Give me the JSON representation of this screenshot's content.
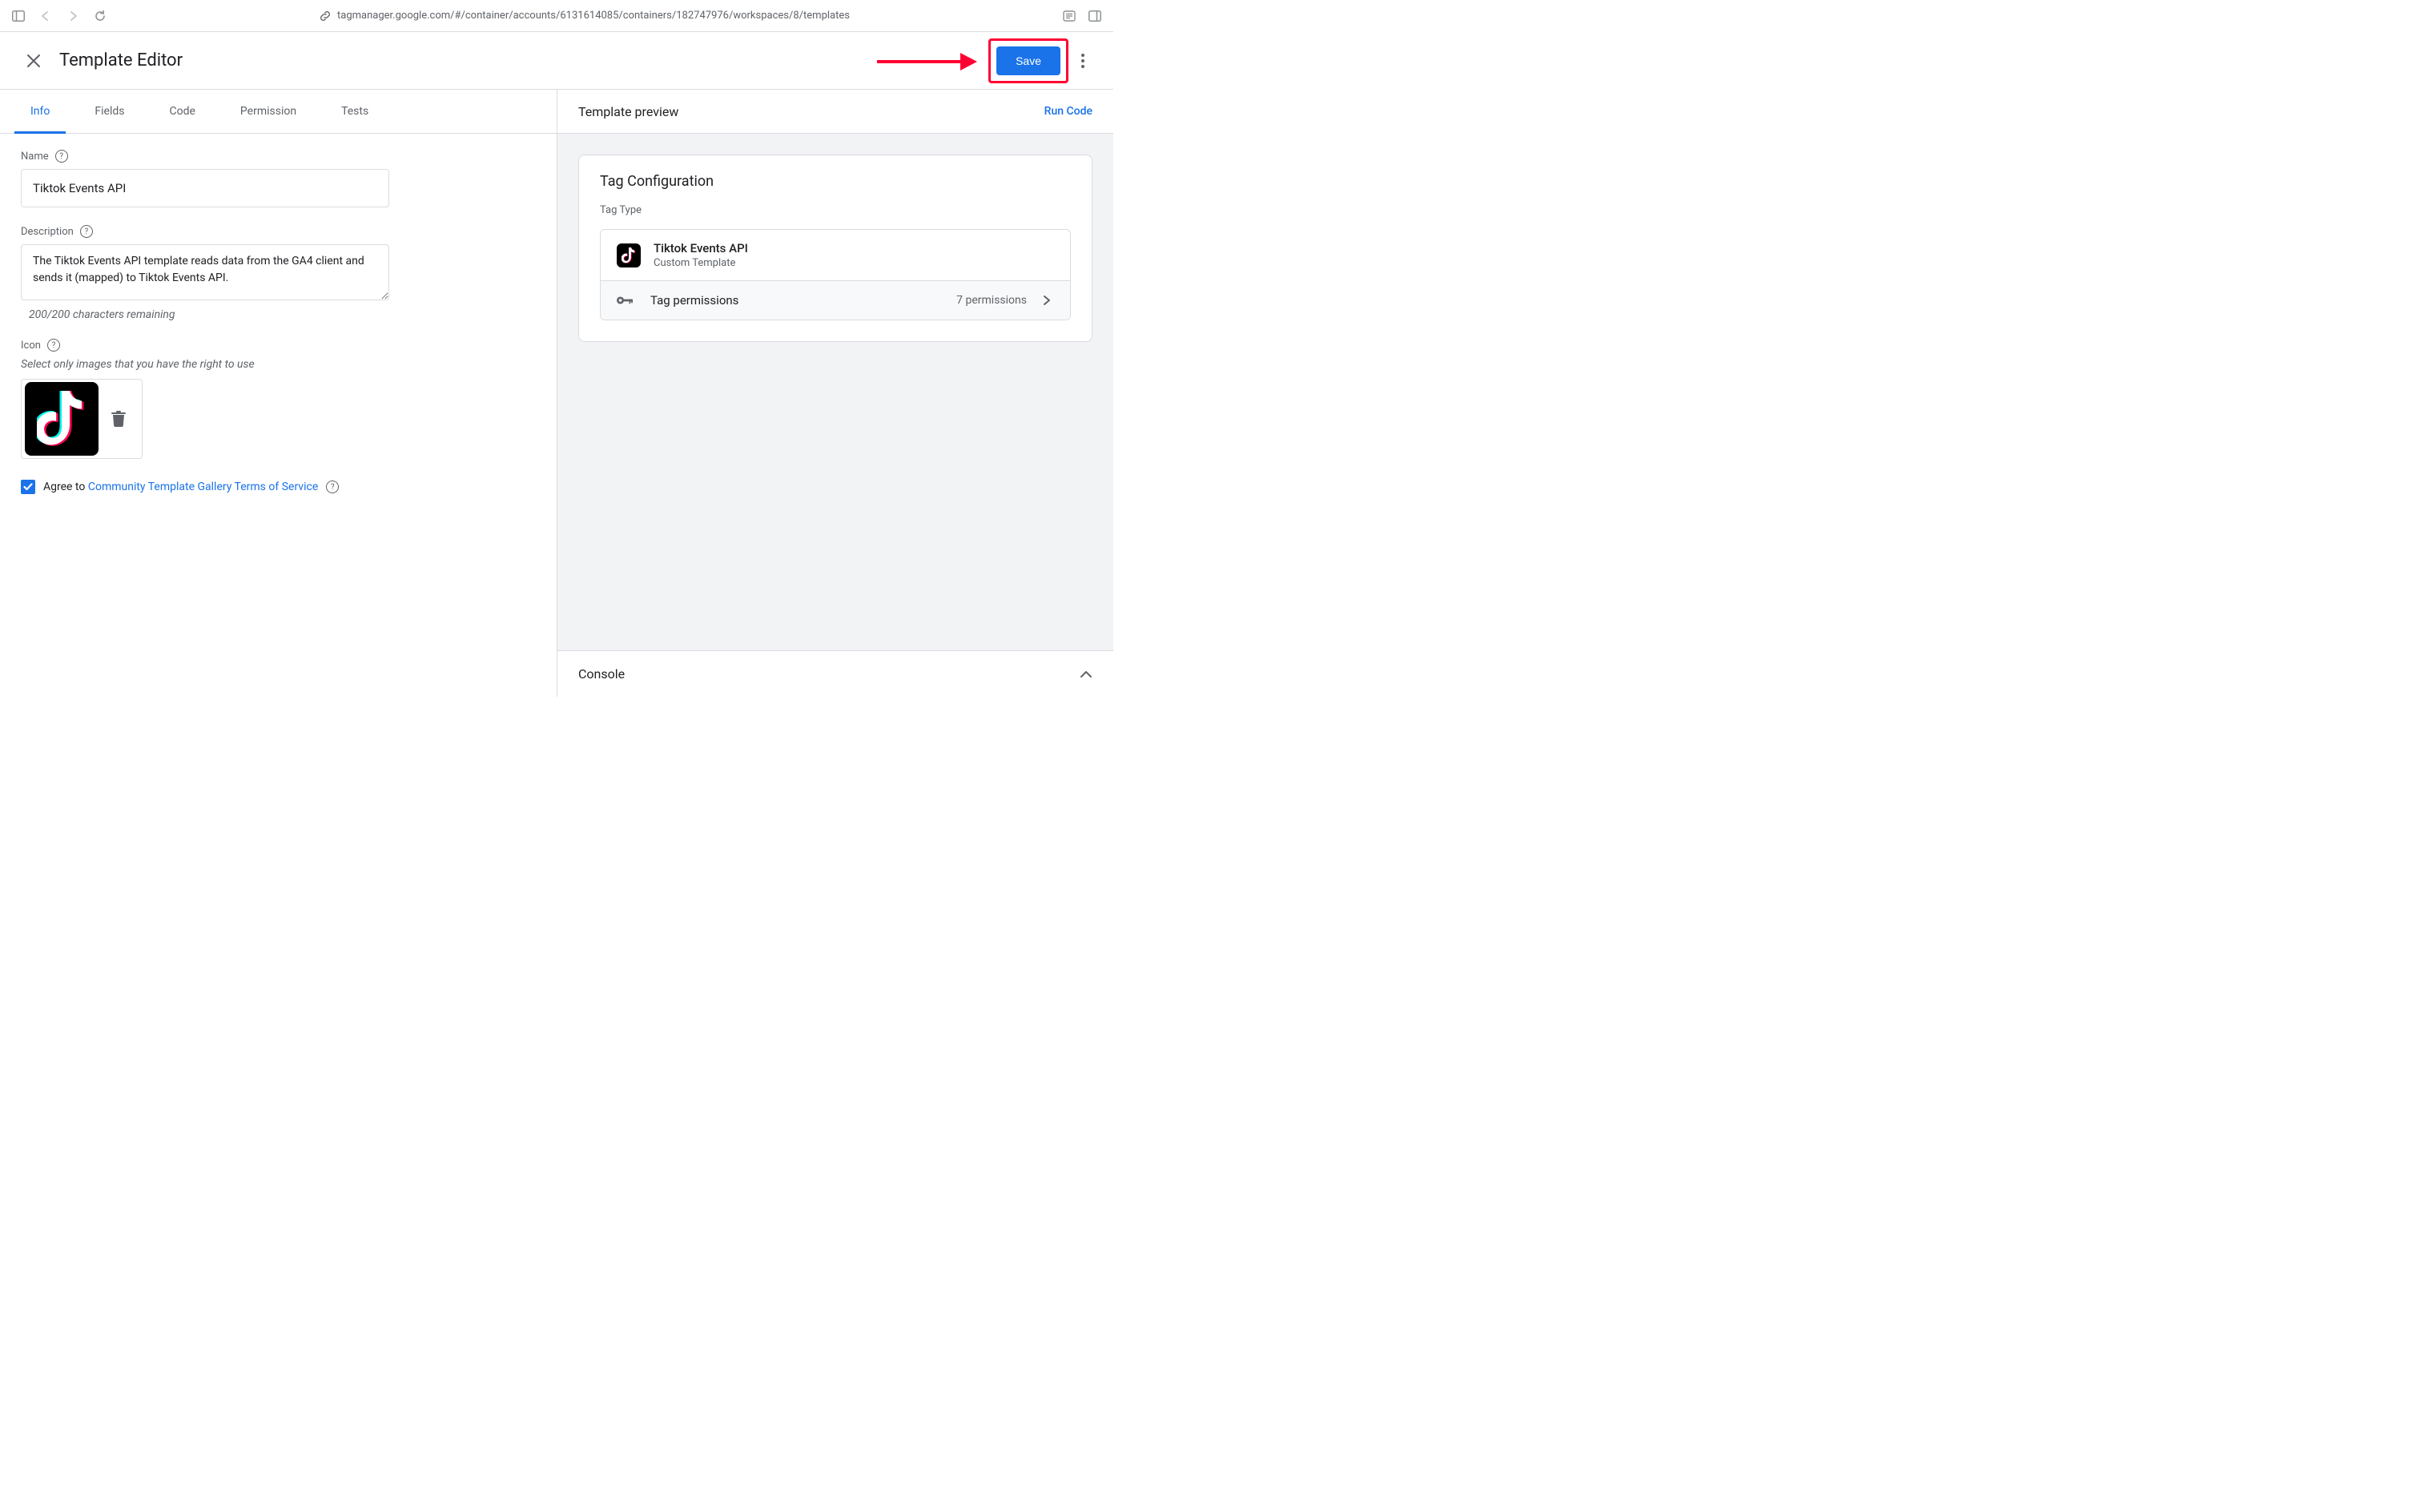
{
  "browser": {
    "url": "tagmanager.google.com/#/container/accounts/6131614085/containers/182747976/workspaces/8/templates"
  },
  "header": {
    "title": "Template Editor",
    "save_label": "Save"
  },
  "tabs": [
    {
      "label": "Info",
      "active": true
    },
    {
      "label": "Fields",
      "active": false
    },
    {
      "label": "Code",
      "active": false
    },
    {
      "label": "Permission",
      "active": false
    },
    {
      "label": "Tests",
      "active": false
    }
  ],
  "form": {
    "name_label": "Name",
    "name_value": "Tiktok Events API",
    "description_label": "Description",
    "description_value": "The Tiktok Events API template reads data from the GA4 client and sends it (mapped) to Tiktok Events API.",
    "char_remaining": "200/200 characters remaining",
    "icon_label": "Icon",
    "icon_hint": "Select only images that you have the right to use",
    "agree_prefix": "Agree to ",
    "agree_link": "Community Template Gallery Terms of Service",
    "agree_checked": true
  },
  "preview": {
    "title": "Template preview",
    "run_code": "Run Code",
    "card_title": "Tag Configuration",
    "tag_type_label": "Tag Type",
    "tag_name": "Tiktok Events API",
    "tag_subtype": "Custom Template",
    "perms_label": "Tag permissions",
    "perms_count": "7 permissions"
  },
  "console": {
    "title": "Console"
  }
}
